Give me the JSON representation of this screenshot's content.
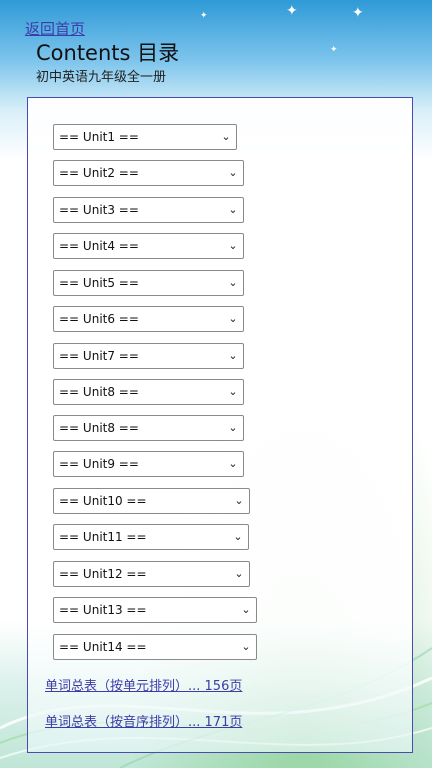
{
  "nav": {
    "back_label": "返回首页"
  },
  "header": {
    "title": "Contents 目录",
    "subtitle": "初中英语九年级全一册"
  },
  "units": [
    {
      "label": "== Unit1 =="
    },
    {
      "label": "== Unit2 =="
    },
    {
      "label": "== Unit3 =="
    },
    {
      "label": "== Unit4 =="
    },
    {
      "label": "== Unit5 =="
    },
    {
      "label": "== Unit6 =="
    },
    {
      "label": "== Unit7 =="
    },
    {
      "label": "== Unit8 =="
    },
    {
      "label": "== Unit8 =="
    },
    {
      "label": "== Unit9 =="
    },
    {
      "label": "== Unit10 =="
    },
    {
      "label": "== Unit11 =="
    },
    {
      "label": "== Unit12 =="
    },
    {
      "label": "== Unit13 =="
    },
    {
      "label": "== Unit14 =="
    }
  ],
  "summary_links": [
    {
      "label": "单词总表（按单元排列）... 156页"
    },
    {
      "label": "单词总表（按音序排列）... 171页"
    }
  ],
  "colors": {
    "link": "#3c3ca8",
    "panel_border": "#4a4ab0",
    "sky_top": "#2f9ad7"
  }
}
